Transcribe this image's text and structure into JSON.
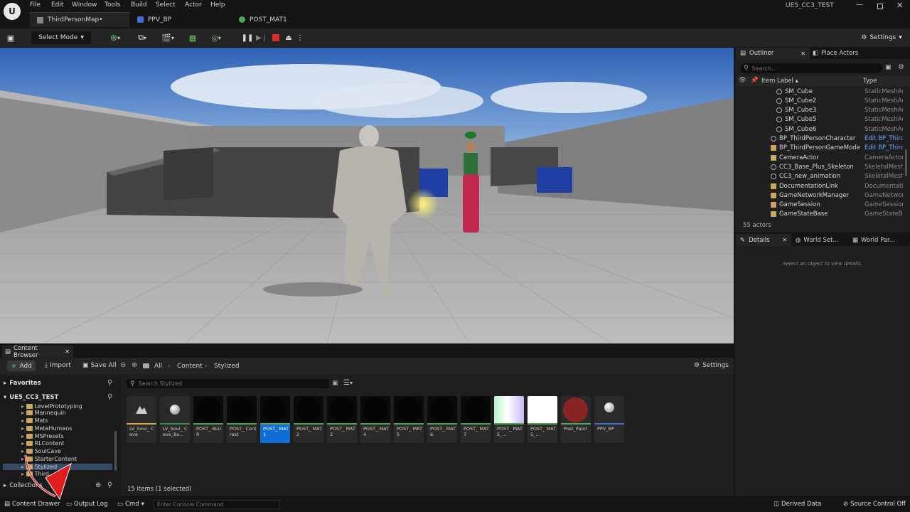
{
  "menu": [
    "File",
    "Edit",
    "Window",
    "Tools",
    "Build",
    "Select",
    "Actor",
    "Help"
  ],
  "project_name": "UE5_CC3_TEST",
  "tabs": [
    {
      "label": "ThirdPersonMap•"
    },
    {
      "label": "PPV_BP"
    },
    {
      "label": "POST_MAT1"
    }
  ],
  "toolbar": {
    "select_mode": "Select Mode",
    "settings": "Settings"
  },
  "outliner": {
    "tab": "Outliner",
    "place_actors": "Place Actors",
    "search_placeholder": "Search...",
    "col_label": "Item Label ▴",
    "col_type": "Type",
    "rows": [
      {
        "label": "SM_Cube",
        "type": "StaticMeshAc",
        "indent": 62,
        "link": false
      },
      {
        "label": "SM_Cube2",
        "type": "StaticMeshAc",
        "indent": 62,
        "link": false
      },
      {
        "label": "SM_Cube3",
        "type": "StaticMeshAc",
        "indent": 62,
        "link": false
      },
      {
        "label": "SM_Cube5",
        "type": "StaticMeshAc",
        "indent": 62,
        "link": false
      },
      {
        "label": "SM_Cube6",
        "type": "StaticMeshAc",
        "indent": 62,
        "link": false
      },
      {
        "label": "BP_ThirdPersonCharacter",
        "type": "Edit BP_Third",
        "indent": 54,
        "link": true
      },
      {
        "label": "BP_ThirdPersonGameMode",
        "type": "Edit BP_Third",
        "indent": 54,
        "link": true
      },
      {
        "label": "CameraActor",
        "type": "CameraActor",
        "indent": 54,
        "link": false
      },
      {
        "label": "CC3_Base_Plus_Skeleton",
        "type": "SkeletalMesh",
        "indent": 54,
        "link": false
      },
      {
        "label": "CC3_new_animation",
        "type": "SkeletalMesh",
        "indent": 54,
        "link": false
      },
      {
        "label": "DocumentationLink",
        "type": "Documentatio",
        "indent": 54,
        "link": false
      },
      {
        "label": "GameNetworkManager",
        "type": "GameNetworl",
        "indent": 54,
        "link": false
      },
      {
        "label": "GameSession",
        "type": "GameSession",
        "indent": 54,
        "link": false
      },
      {
        "label": "GameStateBase",
        "type": "GameStateBa",
        "indent": 54,
        "link": false
      }
    ],
    "actor_count": "55 actors"
  },
  "details": {
    "tab": "Details",
    "world_settings": "World Set...",
    "world_partition": "World Par...",
    "empty": "Select an object to view details."
  },
  "content_browser": {
    "tab": "Content Browser",
    "add": "Add",
    "import": "Import",
    "save_all": "Save All",
    "breadcrumb": [
      "All",
      "Content",
      "Stylized"
    ],
    "settings": "Settings",
    "favorites": "Favorites",
    "project": "UE5_CC3_TEST",
    "folders": [
      "LevelPrototyping",
      "Mannequin",
      "Mats",
      "MetaHumans",
      "MSPresets",
      "RLContent",
      "SoulCave",
      "StarterContent",
      "Stylized",
      "Third"
    ],
    "collections": "Collections",
    "search_placeholder": "Search Stylized",
    "status": "15 items (1 selected)",
    "assets": [
      {
        "name": "LV_Soul_ Cave",
        "kind": "level",
        "bar": "#d9a441"
      },
      {
        "name": "LV_Soul_ Cave_Bu...",
        "kind": "sphere",
        "bar": "#3b8d3b"
      },
      {
        "name": "POST_ BLUR",
        "kind": "dark",
        "bar": "#4ea84e"
      },
      {
        "name": "POST_ Contrast",
        "kind": "dark",
        "bar": "#4ea84e"
      },
      {
        "name": "POST_ MAT1",
        "kind": "dark",
        "bar": "#4ea84e"
      },
      {
        "name": "POST_ MAT2",
        "kind": "dark",
        "bar": "#4ea84e"
      },
      {
        "name": "POST_ MAT3",
        "kind": "dark",
        "bar": "#4ea84e"
      },
      {
        "name": "POST_ MAT4",
        "kind": "dark",
        "bar": "#4ea84e"
      },
      {
        "name": "POST_ MAT5",
        "kind": "dark",
        "bar": "#4ea84e"
      },
      {
        "name": "POST_ MAT6",
        "kind": "dark",
        "bar": "#4ea84e"
      },
      {
        "name": "POST_ MAT7",
        "kind": "dark",
        "bar": "#4ea84e"
      },
      {
        "name": "POST_ MAT5_...",
        "kind": "gradient",
        "bar": "#4ea84e"
      },
      {
        "name": "POST_ MAT5_...",
        "kind": "white",
        "bar": "#4ea84e"
      },
      {
        "name": "Post_Paint",
        "kind": "red",
        "bar": "#4ea84e"
      },
      {
        "name": "PPV_BP",
        "kind": "ppv",
        "bar": "#3f6fd6"
      }
    ]
  },
  "statusbar": {
    "content_drawer": "Content Drawer",
    "output_log": "Output Log",
    "cmd": "Cmd",
    "console_placeholder": "Enter Console Command",
    "derived_data": "Derived Data",
    "source_control": "Source Control Off"
  },
  "colors": {
    "accent": "#0f6ed6",
    "link": "#6aa7ff",
    "folder": "#c9a85c"
  }
}
